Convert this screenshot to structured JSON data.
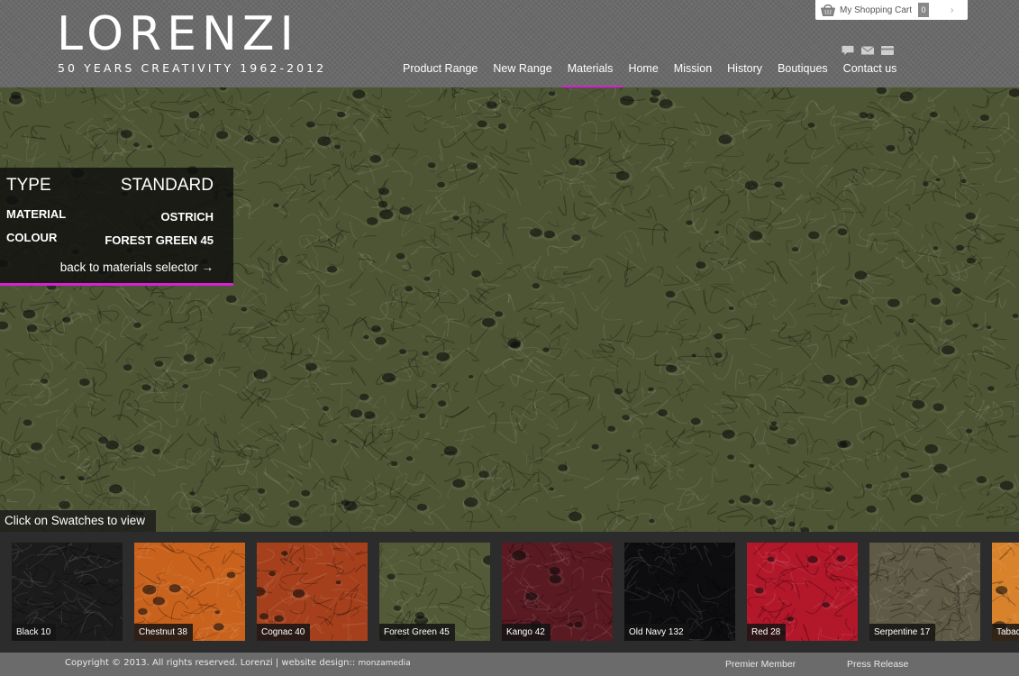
{
  "brand": {
    "name": "LORENZI",
    "tagline": "50 YEARS CREATIVITY 1962-2012"
  },
  "cart": {
    "label": "My Shopping Cart",
    "count": "0",
    "arrow": "›"
  },
  "header_icons": [
    "comment-icon",
    "mail-icon",
    "card-icon"
  ],
  "nav": {
    "items": [
      {
        "label": "Product Range",
        "active": false
      },
      {
        "label": "New Range",
        "active": false
      },
      {
        "label": "Materials",
        "active": true
      },
      {
        "label": "Home",
        "active": false
      },
      {
        "label": "Mission",
        "active": false
      },
      {
        "label": "History",
        "active": false
      },
      {
        "label": "Boutiques",
        "active": false
      },
      {
        "label": "Contact us",
        "active": false
      }
    ],
    "active_color": "#d81fd8"
  },
  "info": {
    "type_label": "TYPE",
    "type_value": "STANDARD",
    "material_label": "MATERIAL",
    "material_value": "OSTRICH",
    "colour_label": "COLOUR",
    "colour_value": "FOREST GREEN 45",
    "back_link": "back to materials selector →"
  },
  "hero": {
    "color": "#4d5534"
  },
  "swatch_hint": "Click on Swatches to view",
  "swatches": [
    {
      "label": "Black 10",
      "color": "#1b1b1b",
      "texture": "croc"
    },
    {
      "label": "Chestnut 38",
      "color": "#c9621c",
      "texture": "ostrich"
    },
    {
      "label": "Cognac 40",
      "color": "#a6401c",
      "texture": "ostrich"
    },
    {
      "label": "Forest Green 45",
      "color": "#525a37",
      "texture": "ostrich"
    },
    {
      "label": "Kango 42",
      "color": "#5a1a22",
      "texture": "ostrich"
    },
    {
      "label": "Old Navy 132",
      "color": "#0d0d10",
      "texture": "croc"
    },
    {
      "label": "Red 28",
      "color": "#b3172a",
      "texture": "ostrich"
    },
    {
      "label": "Serpentine 17",
      "color": "#5e5a45",
      "texture": "croc"
    },
    {
      "label": "Tabacco",
      "color": "#d9822c",
      "texture": "ostrich"
    }
  ],
  "footer": {
    "copyright": "Copyright © 2013. All rights reserved. Lorenzi | website design:: ",
    "design_credit": "monzamedia",
    "premier": "Premier Member",
    "press": "Press Release"
  }
}
